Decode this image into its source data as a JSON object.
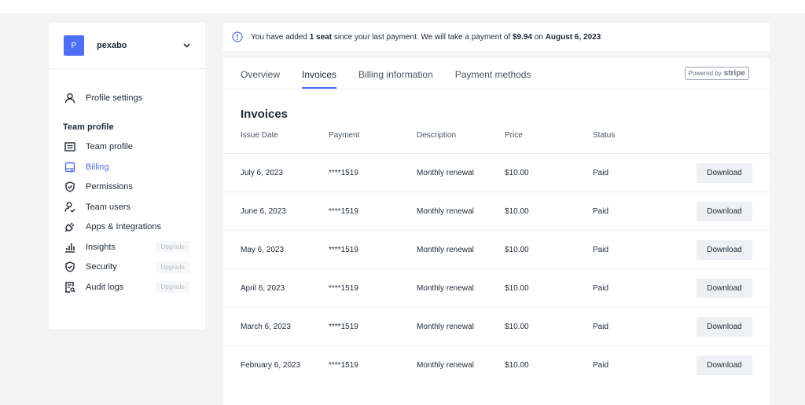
{
  "team": {
    "avatar_letter": "P",
    "name": "pexabo"
  },
  "sidebar": {
    "profile_settings": "Profile settings",
    "section_title": "Team profile",
    "items": [
      {
        "label": "Team profile",
        "icon": "id-card-icon"
      },
      {
        "label": "Billing",
        "icon": "billing-icon",
        "active": true
      },
      {
        "label": "Permissions",
        "icon": "shield-check-icon"
      },
      {
        "label": "Team users",
        "icon": "user-check-icon"
      },
      {
        "label": "Apps & Integrations",
        "icon": "plug-icon"
      },
      {
        "label": "Insights",
        "icon": "bar-chart-icon",
        "badge": "Upgrade"
      },
      {
        "label": "Security",
        "icon": "shield-icon",
        "badge": "Upgrade"
      },
      {
        "label": "Audit logs",
        "icon": "file-search-icon",
        "badge": "Upgrade"
      }
    ]
  },
  "notice": {
    "text_1": "You have added ",
    "seats": "1 seat",
    "text_2": " since your last payment. We will take a payment of ",
    "amount": "$9.94",
    "text_3": " on ",
    "date": "August 6, 2023"
  },
  "tabs": [
    "Overview",
    "Invoices",
    "Billing information",
    "Payment methods"
  ],
  "active_tab": "Invoices",
  "powered_by": {
    "prefix": "Powered by",
    "brand": "stripe"
  },
  "invoices": {
    "title": "Invoices",
    "headers": [
      "Issue Date",
      "Payment",
      "Description",
      "Price",
      "Status"
    ],
    "download_label": "Download",
    "rows": [
      {
        "date": "July 6, 2023",
        "payment": "****1519",
        "description": "Monthly renewal",
        "price": "$10.00",
        "status": "Paid"
      },
      {
        "date": "June 6, 2023",
        "payment": "****1519",
        "description": "Monthly renewal",
        "price": "$10.00",
        "status": "Paid"
      },
      {
        "date": "May 6, 2023",
        "payment": "****1519",
        "description": "Monthly renewal",
        "price": "$10.00",
        "status": "Paid"
      },
      {
        "date": "April 6, 2023",
        "payment": "****1519",
        "description": "Monthly renewal",
        "price": "$10.00",
        "status": "Paid"
      },
      {
        "date": "March 6, 2023",
        "payment": "****1519",
        "description": "Monthly renewal",
        "price": "$10.00",
        "status": "Paid"
      },
      {
        "date": "February 6, 2023",
        "payment": "****1519",
        "description": "Monthly renewal",
        "price": "$10.00",
        "status": "Paid"
      }
    ]
  },
  "colors": {
    "accent": "#4f6ef7",
    "background": "#f4f4f5"
  }
}
